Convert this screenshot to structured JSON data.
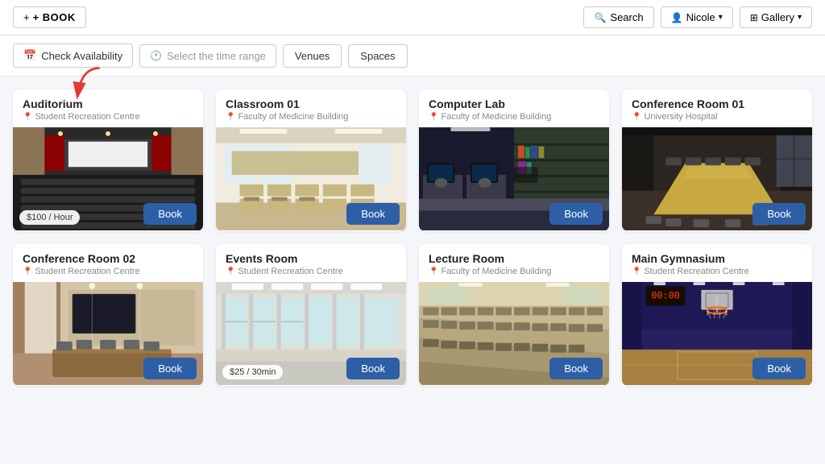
{
  "header": {
    "book_label": "+ BOOK",
    "search_label": "Search",
    "user_label": "Nicole",
    "gallery_label": "Gallery"
  },
  "filters": {
    "check_availability": "Check Availability",
    "time_range_placeholder": "Select the time range",
    "venues_label": "Venues",
    "spaces_label": "Spaces"
  },
  "rooms": [
    {
      "id": "auditorium",
      "title": "Auditorium",
      "subtitle": "Student Recreation Centre",
      "price": "$100 / Hour",
      "has_price": true,
      "color": "#2a2a2a",
      "accent": "#8b0000",
      "theme": "auditorium"
    },
    {
      "id": "classroom01",
      "title": "Classroom 01",
      "subtitle": "Faculty of Medicine Building",
      "price": null,
      "has_price": false,
      "color": "#e8e4d0",
      "accent": "#c8c090",
      "theme": "classroom"
    },
    {
      "id": "computer-lab",
      "title": "Computer Lab",
      "subtitle": "Faculty of Medicine Building",
      "price": null,
      "has_price": false,
      "color": "#1a1a2e",
      "accent": "#2d4a6e",
      "theme": "computer-lab"
    },
    {
      "id": "conference-room-01",
      "title": "Conference Room 01",
      "subtitle": "University Hospital",
      "price": null,
      "has_price": false,
      "color": "#3a3530",
      "accent": "#c8a860",
      "theme": "conference01"
    },
    {
      "id": "conference-room-02",
      "title": "Conference Room 02",
      "subtitle": "Student Recreation Centre",
      "price": null,
      "has_price": false,
      "color": "#c9b99a",
      "accent": "#8b7355",
      "theme": "conference02"
    },
    {
      "id": "events-room",
      "title": "Events Room",
      "subtitle": "Student Recreation Centre",
      "price": "$25 / 30min",
      "has_price": true,
      "color": "#e0e0d8",
      "accent": "#b0b0a8",
      "theme": "events"
    },
    {
      "id": "lecture-room",
      "title": "Lecture Room",
      "subtitle": "Faculty of Medicine Building",
      "price": null,
      "has_price": false,
      "color": "#d4c9a8",
      "accent": "#a89870",
      "theme": "lecture"
    },
    {
      "id": "main-gymnasium",
      "title": "Main Gymnasium",
      "subtitle": "Student Recreation Centre",
      "price": null,
      "has_price": false,
      "color": "#2a2060",
      "accent": "#4a3090",
      "theme": "gymnasium"
    }
  ],
  "book_label": "Book",
  "icons": {
    "plus": "+",
    "calendar": "📅",
    "clock": "🕐",
    "search": "🔍",
    "user": "👤",
    "grid": "⊞",
    "location": "📍"
  }
}
